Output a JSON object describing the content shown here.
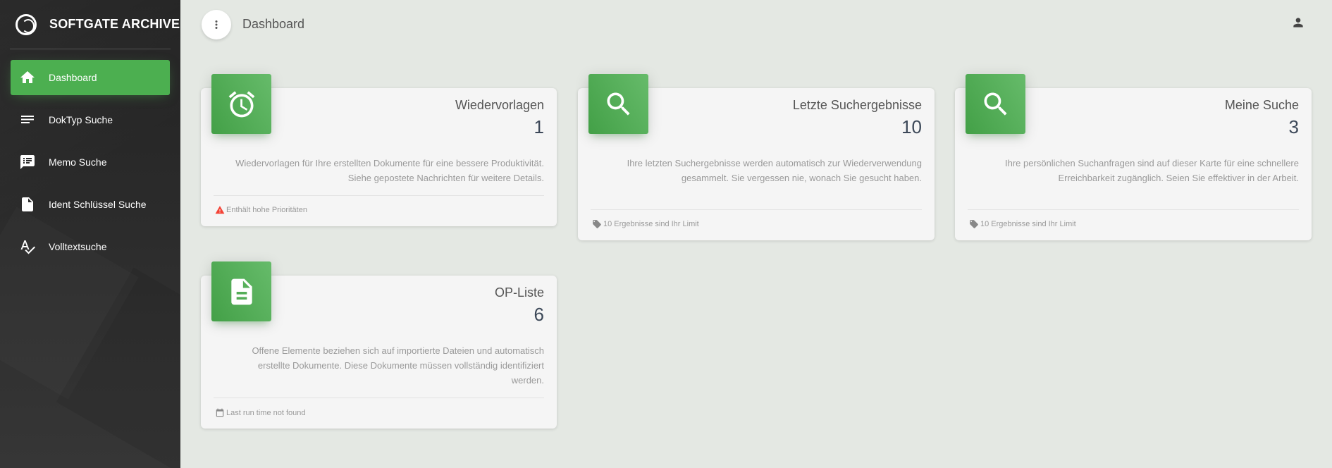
{
  "app": {
    "title": "SOFTGATE ARCHIVE"
  },
  "sidebar": {
    "items": [
      {
        "label": "Dashboard",
        "icon": "home-icon",
        "active": true
      },
      {
        "label": "DokTyp Suche",
        "icon": "list-lines-icon",
        "active": false
      },
      {
        "label": "Memo Suche",
        "icon": "chat-list-icon",
        "active": false
      },
      {
        "label": "Ident Schlüssel Suche",
        "icon": "document-icon",
        "active": false
      },
      {
        "label": "Volltextsuche",
        "icon": "spellcheck-icon",
        "active": false
      }
    ]
  },
  "topbar": {
    "page_title": "Dashboard",
    "menu_icon": "more-vertical-icon",
    "user_icon": "person-icon"
  },
  "cards": [
    {
      "title": "Wiedervorlagen",
      "value": "1",
      "icon": "alarm-clock-icon",
      "description": "Wiedervorlagen für Ihre erstellten Dokumente für eine bessere Produktivität. Siehe gepostete Nachrichten für weitere Details.",
      "footer": "Enthält hohe Prioritäten",
      "footer_icon": "warning-icon"
    },
    {
      "title": "Letzte Suchergebnisse",
      "value": "10",
      "icon": "search-icon",
      "description": "Ihre letzten Suchergebnisse werden automatisch zur Wiederverwendung gesammelt. Sie vergessen nie, wonach Sie gesucht haben.",
      "footer": "10 Ergebnisse sind Ihr Limit",
      "footer_icon": "tag-icon"
    },
    {
      "title": "Meine Suche",
      "value": "3",
      "icon": "search-icon",
      "description": "Ihre persönlichen Suchanfragen sind auf dieser Karte für eine schnellere Erreichbarkeit zugänglich. Seien Sie effektiver in der Arbeit.",
      "footer": "10 Ergebnisse sind Ihr Limit",
      "footer_icon": "tag-icon"
    },
    {
      "title": "OP-Liste",
      "value": "6",
      "icon": "document-icon",
      "description": "Offene Elemente beziehen sich auf importierte Dateien und automatisch erstellte Dokumente. Diese Dokumente müssen vollständig identifiziert werden.",
      "footer": "Last run time not found",
      "footer_icon": "calendar-icon"
    }
  ],
  "colors": {
    "accent": "#4caf50",
    "warning": "#f44336",
    "sidebar": "#2b2b2b"
  }
}
